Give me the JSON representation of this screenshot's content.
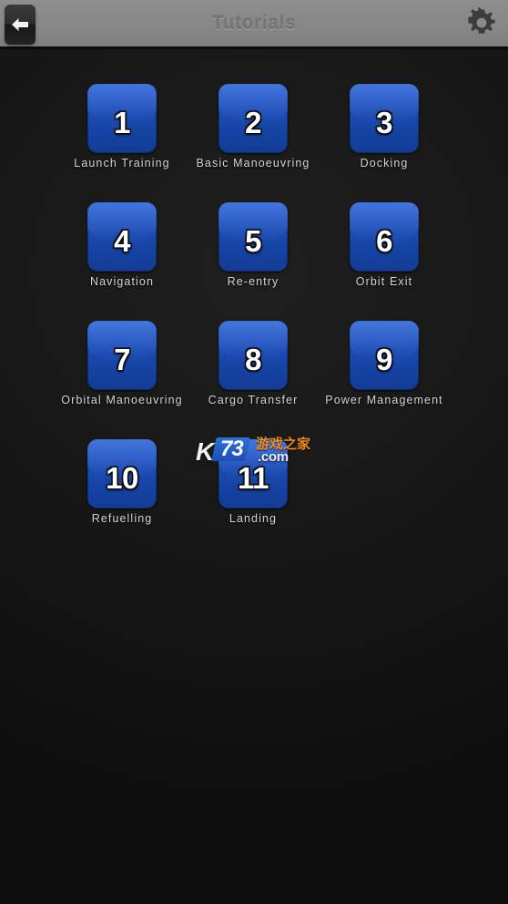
{
  "header": {
    "title": "Tutorials",
    "back_icon": "arrow-left-icon",
    "settings_icon": "gear-icon"
  },
  "watermark": {
    "letter": "K",
    "digits": "73",
    "chinese": "游戏之家",
    "domain": ".com"
  },
  "grid": {
    "rows": [
      [
        {
          "number": "1",
          "label": "Launch Training"
        },
        {
          "number": "2",
          "label": "Basic Manoeuvring"
        },
        {
          "number": "3",
          "label": "Docking"
        }
      ],
      [
        {
          "number": "4",
          "label": "Navigation"
        },
        {
          "number": "5",
          "label": "Re-entry"
        },
        {
          "number": "6",
          "label": "Orbit Exit"
        }
      ],
      [
        {
          "number": "7",
          "label": "Orbital Manoeuvring"
        },
        {
          "number": "8",
          "label": "Cargo Transfer"
        },
        {
          "number": "9",
          "label": "Power Management"
        }
      ],
      [
        {
          "number": "10",
          "label": "Refuelling"
        },
        {
          "number": "11",
          "label": "Landing"
        },
        {
          "number": "",
          "label": ""
        }
      ]
    ]
  },
  "colors": {
    "tile_blue": "#1f4db2",
    "tile_blue_light": "#3a6ed8",
    "background": "#181818",
    "header_gray": "#898989",
    "label_text": "#d4d4d4",
    "watermark_orange": "#f08a1e"
  }
}
